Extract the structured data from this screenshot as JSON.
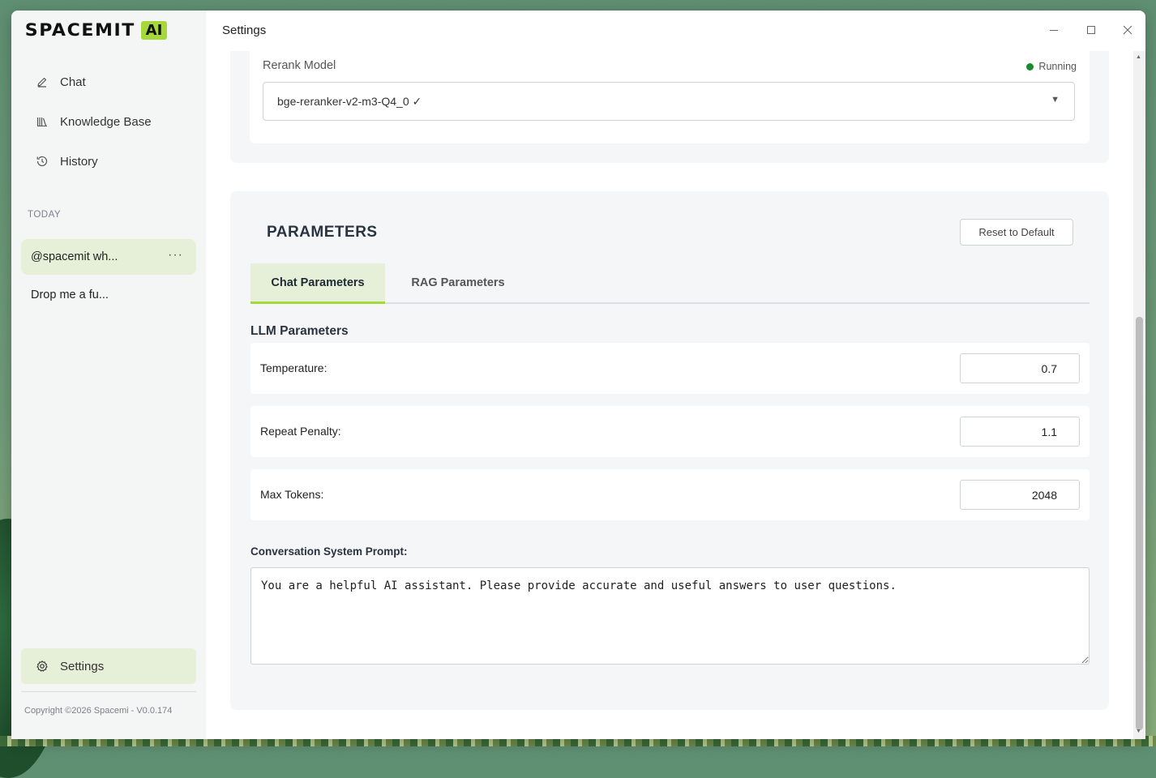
{
  "app": {
    "logo_text": "SPACEMIT",
    "logo_badge": "AI",
    "window_title": "Settings"
  },
  "sidebar": {
    "nav": [
      {
        "label": "Chat",
        "icon": "pencil-icon"
      },
      {
        "label": "Knowledge Base",
        "icon": "books-icon"
      },
      {
        "label": "History",
        "icon": "history-clock-icon"
      }
    ],
    "section_label": "TODAY",
    "history": [
      {
        "label": "@spacemit wh...",
        "active": true
      },
      {
        "label": "Drop me a fu...",
        "active": false
      }
    ],
    "more_label": "···",
    "settings_label": "Settings",
    "copyright": "Copyright ©2026 Spacemi - V0.0.174"
  },
  "rerank": {
    "label": "Rerank Model",
    "status": "Running",
    "status_color": "#1a8a2e",
    "selected": "bge-reranker-v2-m3-Q4_0 ✓",
    "arrow": "▼"
  },
  "parameters": {
    "title": "PARAMETERS",
    "reset_label": "Reset to Default",
    "tabs": [
      {
        "label": "Chat Parameters",
        "active": true
      },
      {
        "label": "RAG Parameters",
        "active": false
      }
    ],
    "llm_heading": "LLM Parameters",
    "rows": [
      {
        "label": "Temperature:",
        "value": "0.7"
      },
      {
        "label": "Repeat Penalty:",
        "value": "1.1"
      },
      {
        "label": "Max Tokens:",
        "value": "2048"
      }
    ],
    "prompt_label": "Conversation System Prompt:",
    "prompt_value": "You are a helpful AI assistant. Please provide accurate and useful answers to user questions."
  },
  "colors": {
    "accent": "#a6d83a",
    "active_bg": "#e6f0d8"
  }
}
